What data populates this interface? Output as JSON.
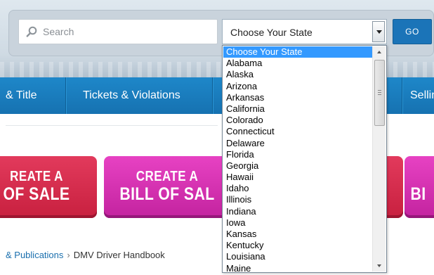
{
  "search": {
    "placeholder": "Search",
    "icon": "search-icon"
  },
  "state_select": {
    "selected": "Choose Your State",
    "options": [
      "Choose Your State",
      "Alabama",
      "Alaska",
      "Arizona",
      "Arkansas",
      "California",
      "Colorado",
      "Connecticut",
      "Delaware",
      "Florida",
      "Georgia",
      "Hawaii",
      "Idaho",
      "Illinois",
      "Indiana",
      "Iowa",
      "Kansas",
      "Kentucky",
      "Louisiana",
      "Maine"
    ],
    "highlight_color": "#3399ff"
  },
  "go_button": {
    "label": "GO"
  },
  "nav": {
    "items": [
      "& Title",
      "Tickets & Violations",
      "Selling"
    ],
    "bar_color": "#1e87c9"
  },
  "banners": [
    {
      "line1": "REATE A",
      "line2": "OF SALE",
      "color": "#d62b4d"
    },
    {
      "line1": "CREATE A",
      "line2": "BILL OF SAL",
      "color": "#d633b1"
    },
    {
      "line1": "",
      "line2": "BI",
      "color": "#d633b1"
    }
  ],
  "breadcrumb": {
    "link": "& Publications",
    "separator": "›",
    "current": "DMV Driver Handbook"
  }
}
